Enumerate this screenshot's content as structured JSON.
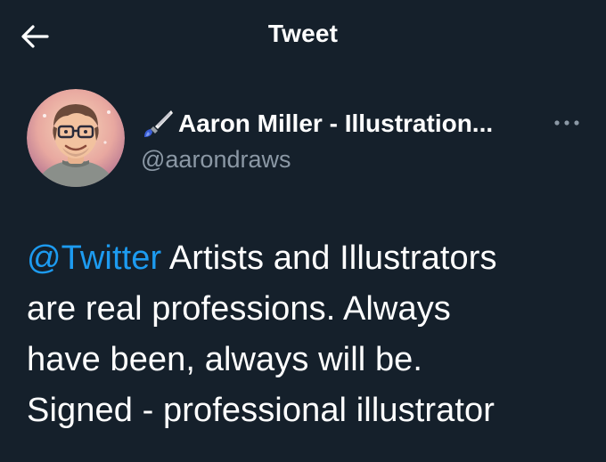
{
  "header": {
    "back_icon": "arrow-left-icon",
    "title": "Tweet"
  },
  "author": {
    "avatar_icon": "avatar-illustration",
    "name_emoji_icon": "paintbrush-icon",
    "display_name": "Aaron Miller - Illustration...",
    "handle": "@aarondraws",
    "more_icon": "more-dots-icon"
  },
  "tweet": {
    "lines": [
      {
        "mention": "@Twitter",
        "text": " Artists and Illustrators"
      },
      {
        "text": "are real professions. Always"
      },
      {
        "text": "have been, always will be."
      },
      {
        "text": "Signed - professional illustrator"
      }
    ]
  },
  "colors": {
    "background": "#15202b",
    "text_primary": "#ffffff",
    "text_secondary": "#8b98a5",
    "accent": "#1d9bf0"
  }
}
